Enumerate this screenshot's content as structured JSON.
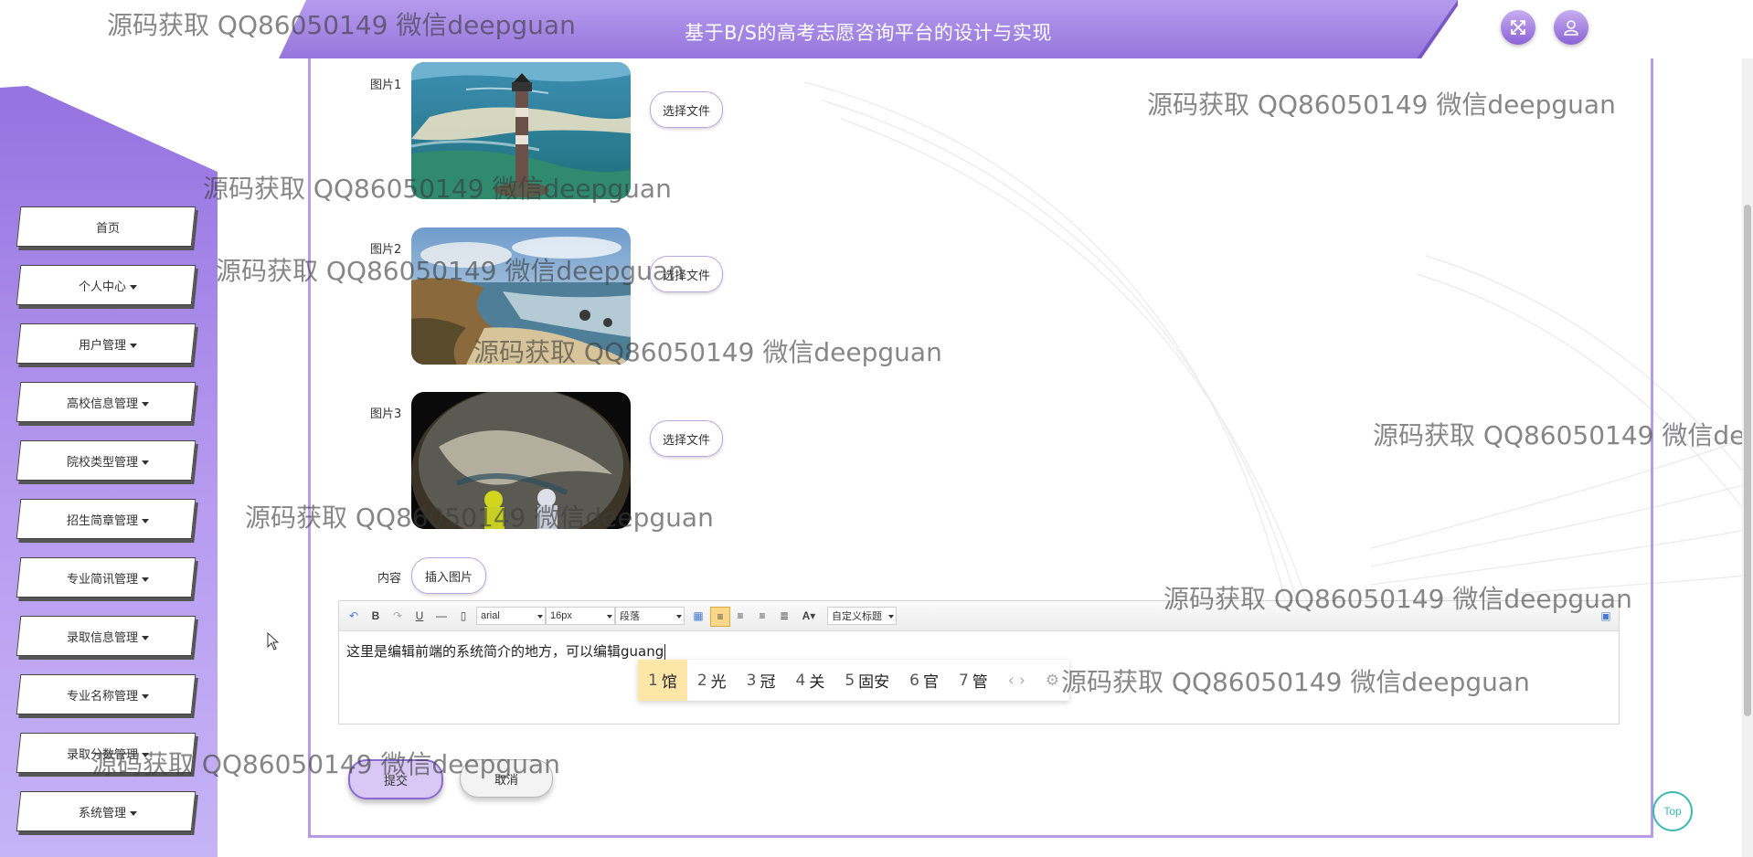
{
  "header": {
    "title": "基于B/S的高考志愿咨询平台的设计与实现",
    "fullscreen_icon": "expand-icon",
    "user_icon": "user-icon"
  },
  "sidebar": {
    "items": [
      {
        "label": "首页",
        "dropdown": false
      },
      {
        "label": "个人中心",
        "dropdown": true
      },
      {
        "label": "用户管理",
        "dropdown": true
      },
      {
        "label": "高校信息管理",
        "dropdown": true
      },
      {
        "label": "院校类型管理",
        "dropdown": true
      },
      {
        "label": "招生简章管理",
        "dropdown": true
      },
      {
        "label": "专业简讯管理",
        "dropdown": true
      },
      {
        "label": "录取信息管理",
        "dropdown": true
      },
      {
        "label": "专业名称管理",
        "dropdown": true
      },
      {
        "label": "录取分数管理",
        "dropdown": true
      },
      {
        "label": "系统管理",
        "dropdown": true
      }
    ]
  },
  "form": {
    "images": [
      {
        "label": "图片1",
        "button": "选择文件",
        "subject": "lighthouse"
      },
      {
        "label": "图片2",
        "button": "选择文件",
        "subject": "coastline"
      },
      {
        "label": "图片3",
        "button": "选择文件",
        "subject": "planet"
      }
    ],
    "content_label": "内容",
    "insert_image_button": "插入图片",
    "submit_label": "提交",
    "cancel_label": "取消"
  },
  "editor": {
    "font_family": "arial",
    "font_size": "16px",
    "paragraph": "段落",
    "custom_heading": "自定义标题",
    "text": "这里是编辑前端的系统简介的地方，可以编辑guang",
    "ime_candidates": [
      {
        "num": "1",
        "text": "馆"
      },
      {
        "num": "2",
        "text": "光"
      },
      {
        "num": "3",
        "text": "冠"
      },
      {
        "num": "4",
        "text": "关"
      },
      {
        "num": "5",
        "text": "固安"
      },
      {
        "num": "6",
        "text": "官"
      },
      {
        "num": "7",
        "text": "管"
      }
    ]
  },
  "watermark": "源码获取 QQ86050149 微信deepguan",
  "top_button": "Top",
  "colors": {
    "accent": "#9b7be0",
    "header": "#a58ae6",
    "ime_selected": "#fde6a8"
  }
}
